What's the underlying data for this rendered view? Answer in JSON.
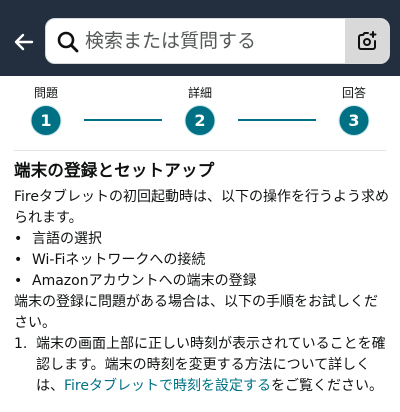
{
  "header": {
    "back_icon": "arrow-left-icon",
    "search": {
      "placeholder": "検索または質問する",
      "value": ""
    },
    "camera_icon": "camera-search-icon",
    "colors": {
      "bar": "#232f3e",
      "accent": "#007185"
    }
  },
  "stepper": {
    "steps": [
      {
        "label": "問題",
        "number": "1"
      },
      {
        "label": "詳細",
        "number": "2"
      },
      {
        "label": "回答",
        "number": "3"
      }
    ]
  },
  "content": {
    "title": "端末の登録とセットアップ",
    "intro": "Fireタブレットの初回起動時は、以下の操作を行うよう求められます。",
    "bullets": [
      "言語の選択",
      "Wi-Fiネットワークへの接続",
      "Amazonアカウントへの端末の登録"
    ],
    "trouble_intro": "端末の登録に問題がある場合は、以下の手順をお試しください。",
    "steps": [
      {
        "number": "1.",
        "text_before": "端末の画面上部に正しい時刻が表示されていることを確認します。端末の時刻を変更する方法について詳しくは、",
        "link": "Fireタブレットで時刻を設定する",
        "text_after": "をご覧ください。"
      }
    ]
  }
}
